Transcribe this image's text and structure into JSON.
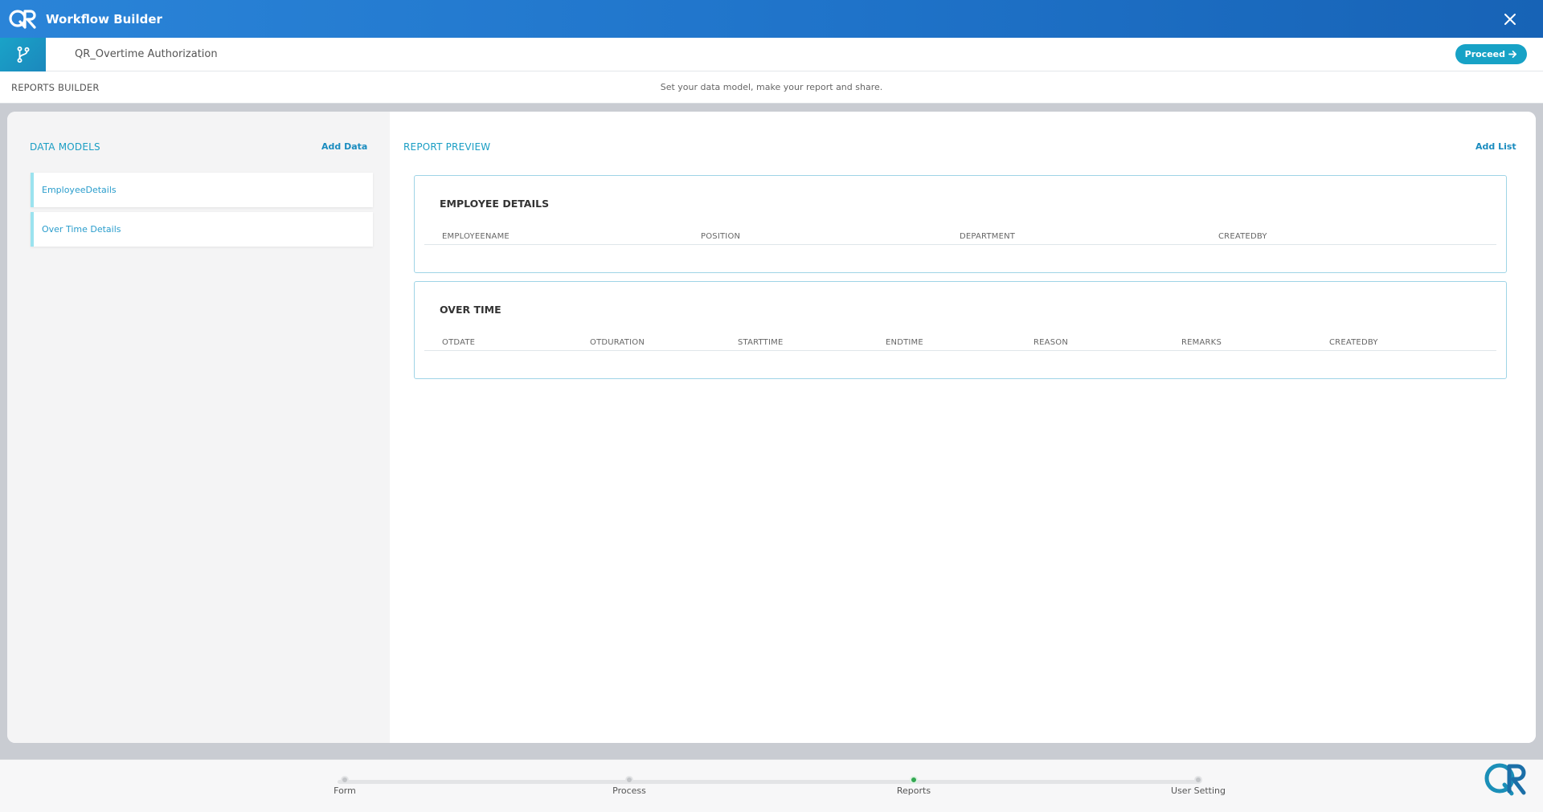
{
  "titlebar": {
    "app_title": "Workflow Builder",
    "logo_icon": "qr-logo-icon",
    "close_icon": "close-icon"
  },
  "workflow": {
    "name": "QR_Overtime Authorization",
    "proceed_label": "Proceed",
    "branch_icon": "branch-icon"
  },
  "subheader": {
    "crumb": "REPORTS BUILDER",
    "tagline": "Set your data model, make your report and share."
  },
  "data_models": {
    "title": "DATA MODELS",
    "add_label": "Add Data",
    "items": [
      {
        "label": "EmployeeDetails"
      },
      {
        "label": "Over Time Details"
      }
    ]
  },
  "report_preview": {
    "title": "REPORT PREVIEW",
    "add_label": "Add List",
    "lists": [
      {
        "title": "EMPLOYEE DETAILS",
        "columns": [
          "EMPLOYEENAME",
          "POSITION",
          "DEPARTMENT",
          "CREATEDBY"
        ]
      },
      {
        "title": "OVER TIME",
        "columns": [
          "OTDATE",
          "OTDURATION",
          "STARTTIME",
          "ENDTIME",
          "REASON",
          "REMARKS",
          "CREATEDBY"
        ]
      }
    ]
  },
  "stepper": {
    "steps": [
      {
        "label": "Form",
        "active": false
      },
      {
        "label": "Process",
        "active": false
      },
      {
        "label": "Reports",
        "active": true
      },
      {
        "label": "User Setting",
        "active": false
      }
    ]
  },
  "colors": {
    "header": "#1f73c9",
    "accent": "#17a2c6",
    "active_step": "#33a852"
  }
}
